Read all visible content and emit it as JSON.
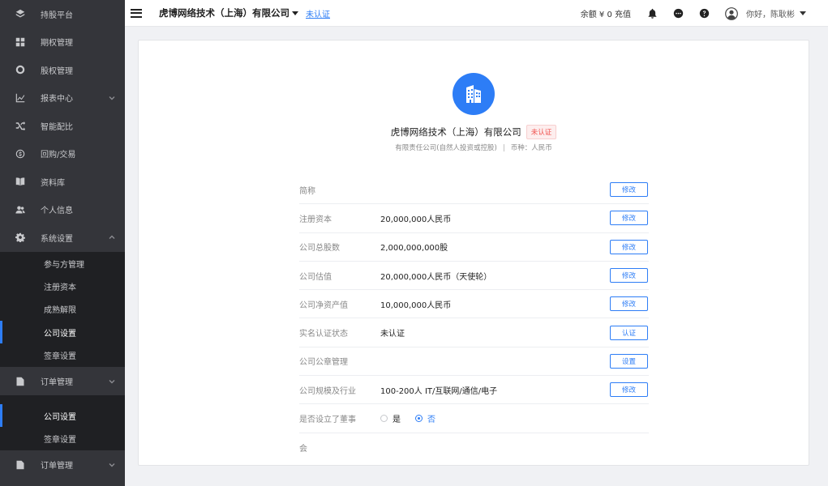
{
  "sidebar": {
    "items": [
      {
        "label": "持股平台",
        "icon": "layers-icon"
      },
      {
        "label": "期权管理",
        "icon": "grid-icon"
      },
      {
        "label": "股权管理",
        "icon": "target-icon"
      },
      {
        "label": "报表中心",
        "icon": "chart-line-icon",
        "expandable": true
      },
      {
        "label": "智能配比",
        "icon": "shuffle-icon"
      },
      {
        "label": "回购/交易",
        "icon": "coin-icon"
      },
      {
        "label": "资料库",
        "icon": "book-icon"
      },
      {
        "label": "个人信息",
        "icon": "users-icon"
      },
      {
        "label": "系统设置",
        "icon": "gear-icon",
        "expanded": true
      }
    ],
    "system_sub": [
      "参与方管理",
      "注册资本",
      "成熟解限",
      "公司设置",
      "签章设置"
    ],
    "order_label": "订单管理",
    "order_sub": [
      "公司设置",
      "签章设置"
    ],
    "order2_label": "订单管理"
  },
  "topbar": {
    "company": "虎博网络技术（上海）有限公司",
    "verify_link": "未认证",
    "balance": "余额 ¥ 0 充值",
    "greeting": "你好，陈耿彬"
  },
  "company": {
    "name": "虎博网络技术（上海）有限公司",
    "badge": "未认证",
    "type": "有限责任公司(自然人投资或控股)",
    "separator": "|",
    "currency": "币种：人民币"
  },
  "rows": [
    {
      "label": "简称",
      "value": "",
      "button": "修改"
    },
    {
      "label": "注册资本",
      "value": "20,000,000人民币",
      "button": "修改"
    },
    {
      "label": "公司总股数",
      "value": "2,000,000,000股",
      "button": "修改"
    },
    {
      "label": "公司估值",
      "value": "20,000,000人民币（天使轮）",
      "button": "修改"
    },
    {
      "label": "公司净资产值",
      "value": "10,000,000人民币",
      "button": "修改"
    },
    {
      "label": "实名认证状态",
      "value": "未认证",
      "button": "认证"
    },
    {
      "label": "公司公章管理",
      "value": "",
      "button": "设置"
    },
    {
      "label": "公司规模及行业",
      "value": "100-200人 IT/互联网/通信/电子",
      "button": "修改"
    }
  ],
  "board_row": {
    "label": "是否设立了董事",
    "option_yes": "是",
    "option_no": "否",
    "selected": "否"
  },
  "last_row": {
    "label": "会"
  },
  "colors": {
    "accent": "#2d7df6",
    "sidebar": "#34353a",
    "submenu": "#1f2023",
    "danger": "#f0514d"
  }
}
